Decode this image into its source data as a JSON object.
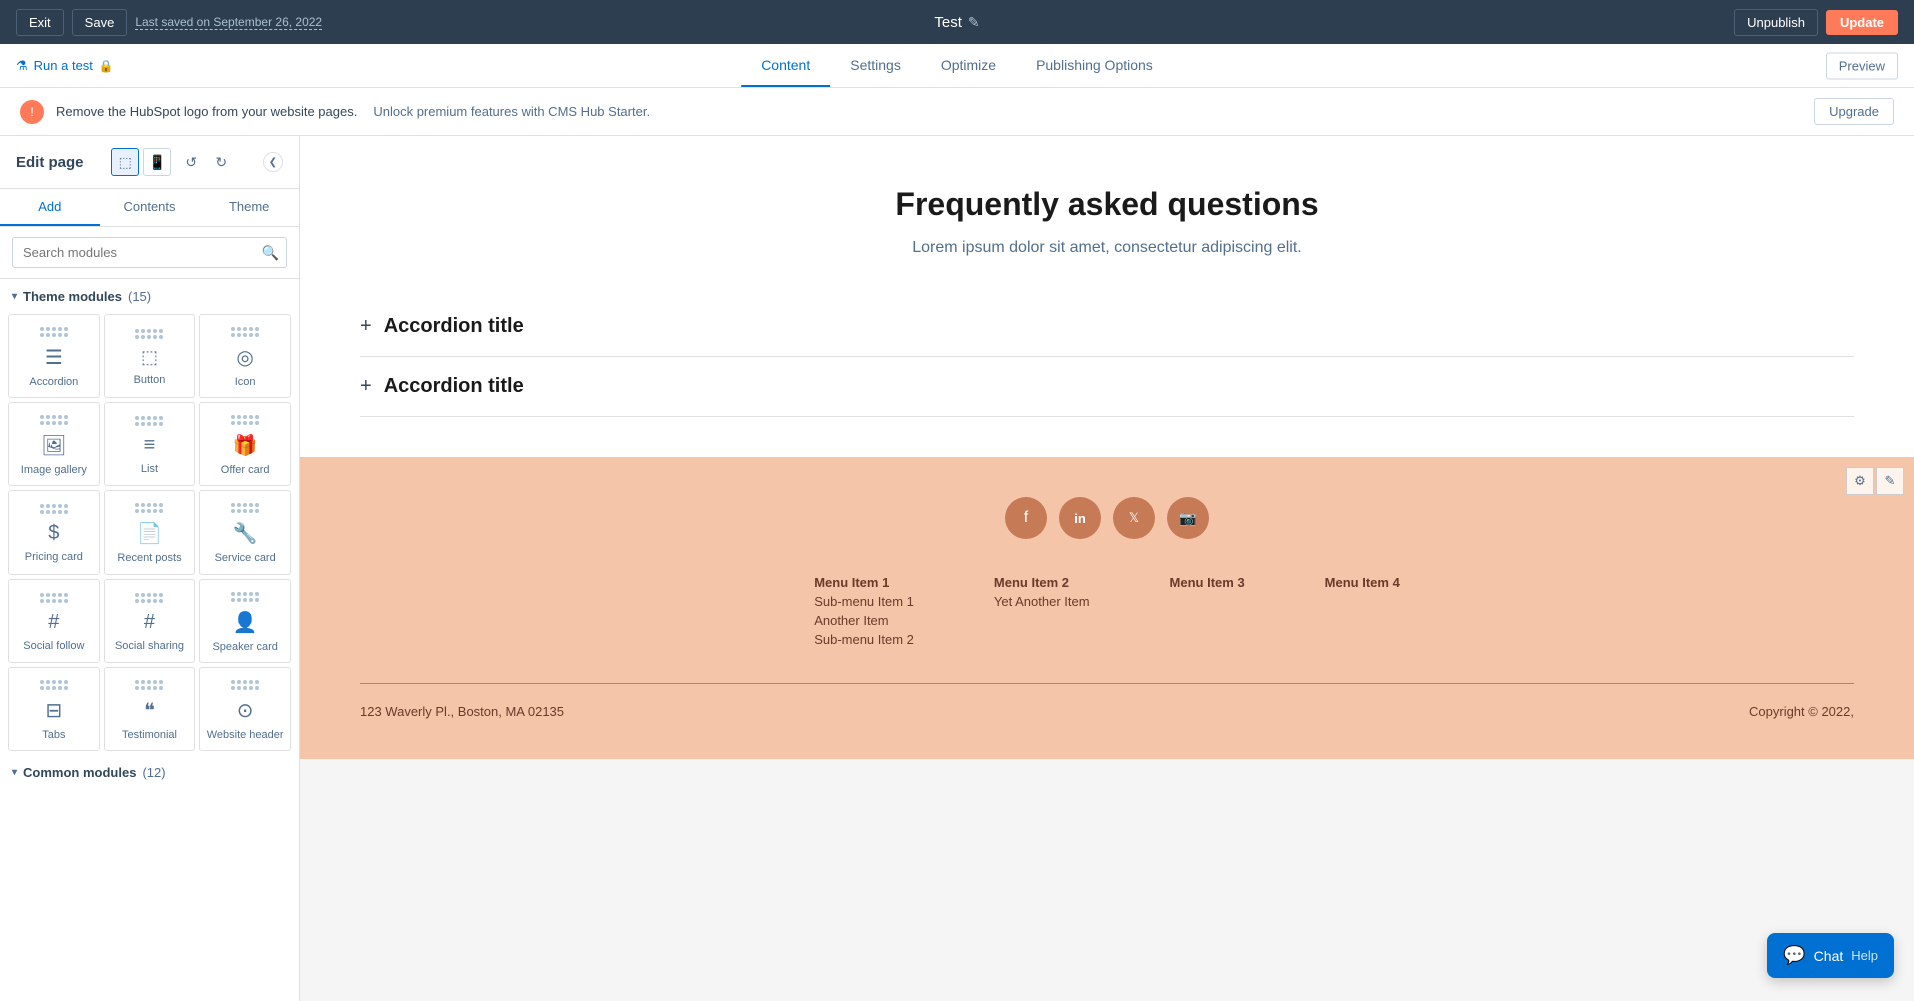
{
  "topbar": {
    "exit_label": "Exit",
    "save_label": "Save",
    "last_saved": "Last saved on September 26, 2022",
    "page_title": "Test",
    "edit_icon": "✎",
    "unpublish_label": "Unpublish",
    "update_label": "Update"
  },
  "navbar": {
    "run_test_label": "Run a test",
    "tabs": [
      {
        "label": "Content",
        "active": true
      },
      {
        "label": "Settings",
        "active": false
      },
      {
        "label": "Optimize",
        "active": false
      },
      {
        "label": "Publishing Options",
        "active": false
      }
    ],
    "preview_label": "Preview"
  },
  "notification": {
    "text": "Remove the HubSpot logo from your website pages.",
    "subtext": "Unlock premium features with CMS Hub Starter.",
    "upgrade_label": "Upgrade"
  },
  "left_panel": {
    "edit_page_title": "Edit page",
    "panel_tabs": [
      "Add",
      "Contents",
      "Theme"
    ],
    "active_tab": "Add",
    "search_placeholder": "Search modules",
    "collapse_arrow": "❮",
    "theme_modules": {
      "label": "Theme modules",
      "count": 15,
      "items": [
        {
          "label": "Accordion",
          "icon": "☰"
        },
        {
          "label": "Button",
          "icon": "⬚"
        },
        {
          "label": "Icon",
          "icon": "◎"
        },
        {
          "label": "Image gallery",
          "icon": "⊞"
        },
        {
          "label": "List",
          "icon": "≡"
        },
        {
          "label": "Offer card",
          "icon": "🎁"
        },
        {
          "label": "Pricing card",
          "icon": "$"
        },
        {
          "label": "Recent posts",
          "icon": "📄"
        },
        {
          "label": "Service card",
          "icon": "🔧"
        },
        {
          "label": "Social follow",
          "icon": "#"
        },
        {
          "label": "Social sharing",
          "icon": "#"
        },
        {
          "label": "Speaker card",
          "icon": "👤"
        },
        {
          "label": "Tabs",
          "icon": "⊟"
        },
        {
          "label": "Testimonial",
          "icon": "❝"
        },
        {
          "label": "Website header",
          "icon": "⊙"
        }
      ]
    },
    "common_modules": {
      "label": "Common modules",
      "count": 12
    }
  },
  "content": {
    "faq": {
      "title": "Frequently asked questions",
      "subtitle": "Lorem ipsum dolor sit amet, consectetur adipiscing elit.",
      "accordion_items": [
        {
          "title": "Accordion title"
        },
        {
          "title": "Accordion title"
        }
      ]
    },
    "footer": {
      "social_icons": [
        "f",
        "in",
        "🐦",
        "📷"
      ],
      "nav_columns": [
        {
          "items": [
            "Menu Item 1",
            "Sub-menu Item 1",
            "Another Item",
            "Sub-menu Item 2"
          ]
        },
        {
          "items": [
            "Menu Item 2",
            "Yet Another Item"
          ]
        },
        {
          "items": [
            "Menu Item 3"
          ]
        },
        {
          "items": [
            "Menu Item 4"
          ]
        }
      ],
      "address": "123 Waverly Pl., Boston, MA 02135",
      "copyright": "Copyright © 2022,"
    }
  },
  "chat_widget": {
    "chat_label": "Chat",
    "help_label": "Help"
  }
}
